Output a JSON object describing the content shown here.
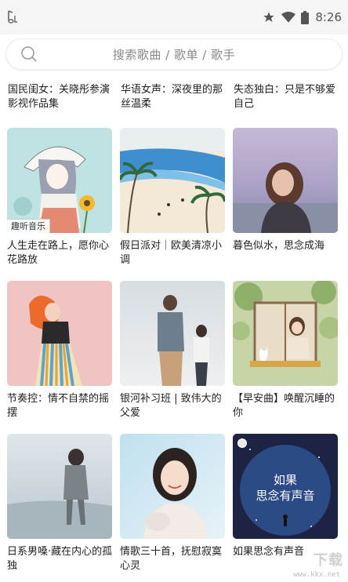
{
  "status_bar": {
    "time": "8:26",
    "icons": [
      "music-note-icon",
      "star-icon",
      "wifi-icon",
      "battery-icon"
    ]
  },
  "search": {
    "placeholder": "搜索歌曲 / 歌单 / 歌手"
  },
  "top_row_titles": [
    "国民闺女：关晓彤参演影视作品集",
    "华语女声：深夜里的那丝温柔",
    "失态独白：只是不够爱自己"
  ],
  "playlists": [
    {
      "title": "人生走在路上，愿你心花路放",
      "tag": "趣听音乐"
    },
    {
      "title": "假日派对｜欧美清凉小调"
    },
    {
      "title": "暮色似水，思念成海"
    },
    {
      "title": "节奏控：情不自禁的摇摆"
    },
    {
      "title": "银河补习班 | 致伟大的父爱"
    },
    {
      "title": "【早安曲】唤醒沉睡的你"
    },
    {
      "title": "日系男嗓·藏在内心的孤独"
    },
    {
      "title": "情歌三十首，抚慰寂寞心灵"
    },
    {
      "title": "如果思念有声音",
      "cover_text": [
        "如果",
        "思念有声音"
      ]
    }
  ],
  "watermark": {
    "text": "下载",
    "url": "www.kkx.net"
  }
}
